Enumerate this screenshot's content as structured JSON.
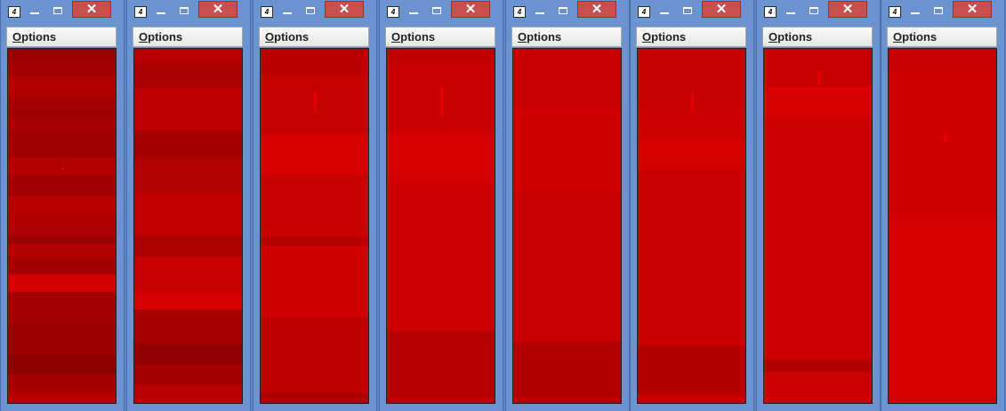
{
  "windows": [
    {
      "menu_label": "Options",
      "mnemonic": "O",
      "rest": "ptions"
    },
    {
      "menu_label": "Options",
      "mnemonic": "O",
      "rest": "ptions"
    },
    {
      "menu_label": "Options",
      "mnemonic": "O",
      "rest": "ptions"
    },
    {
      "menu_label": "Options",
      "mnemonic": "O",
      "rest": "ptions"
    },
    {
      "menu_label": "Options",
      "mnemonic": "O",
      "rest": "ptions"
    },
    {
      "menu_label": "Options",
      "mnemonic": "O",
      "rest": "ptions"
    },
    {
      "menu_label": "Options",
      "mnemonic": "O",
      "rest": "ptions"
    },
    {
      "menu_label": "Options",
      "mnemonic": "O",
      "rest": "ptions"
    }
  ],
  "close_glyph": "✕",
  "icon_glyph": "4",
  "colors": {
    "titlebar": "#6b93d0",
    "close_button": "#c94f4f",
    "content_base": "#c00000"
  }
}
